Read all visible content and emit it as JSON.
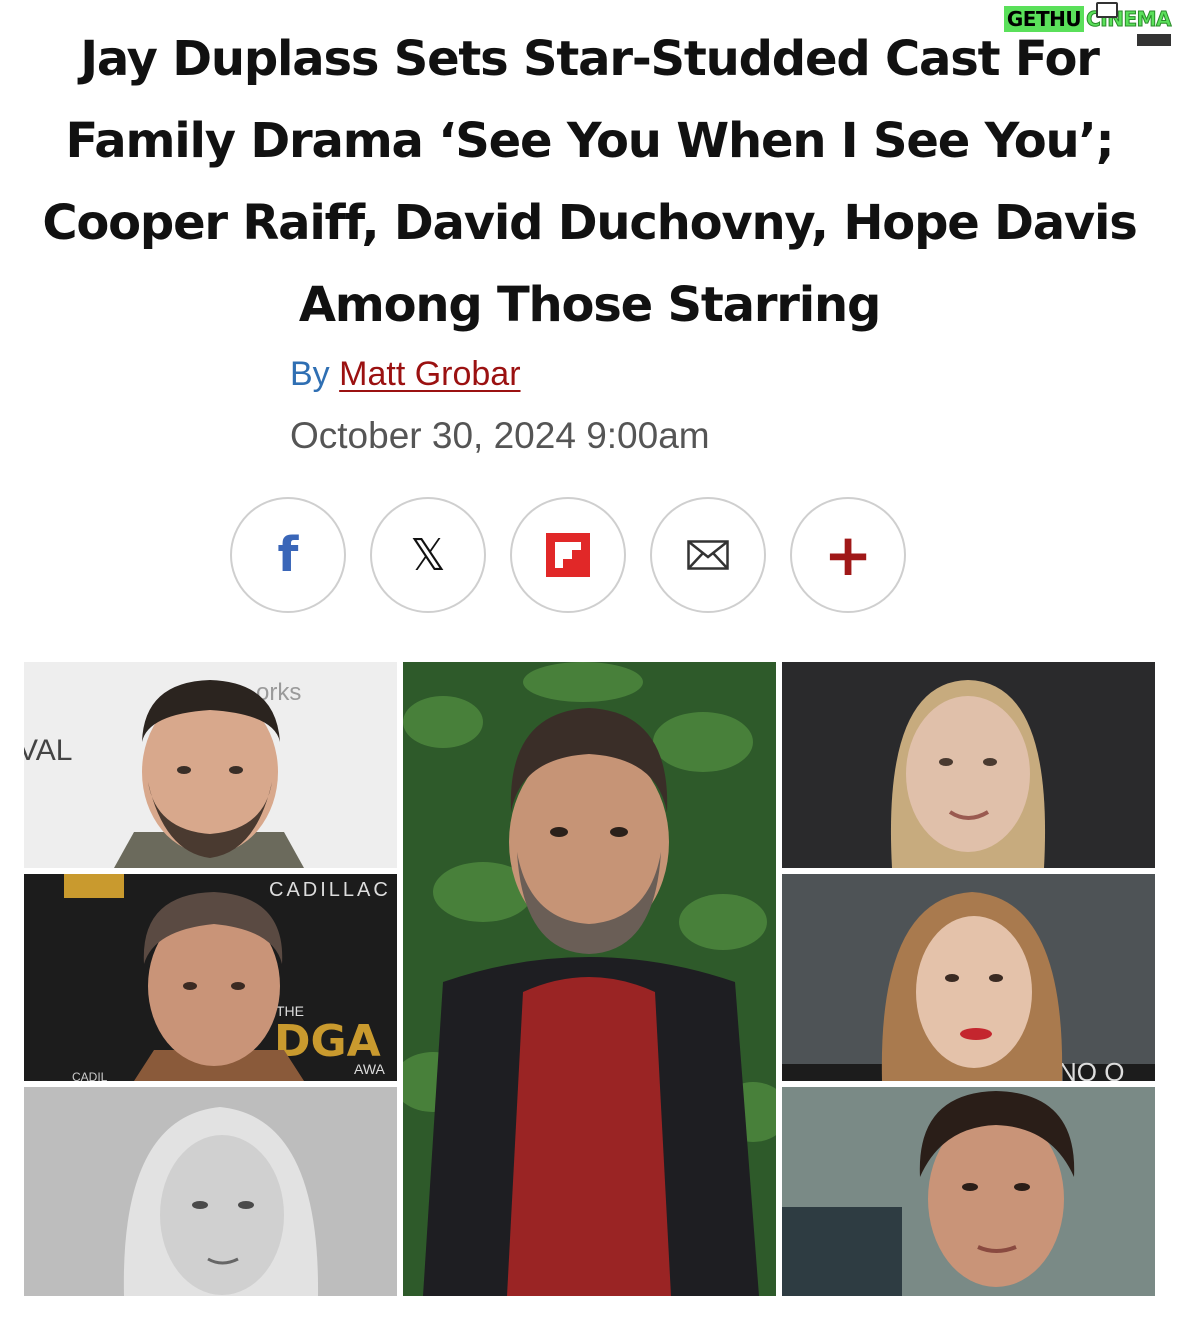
{
  "watermark": {
    "part1": "GETHU",
    "part2": "CINEMA"
  },
  "article": {
    "headline": "Jay Duplass Sets Star-Studded Cast For Family Drama ‘See You When I See You’; Cooper Raiff, David Duchovny, Hope Davis Among Those Starring",
    "byline_prefix": "By",
    "author": "Matt Grobar",
    "date": "October 30, 2024 9:00am"
  },
  "share": [
    {
      "name": "facebook",
      "icon": "facebook-icon"
    },
    {
      "name": "x",
      "icon": "x-icon"
    },
    {
      "name": "flipboard",
      "icon": "flipboard-icon",
      "color": "#e12828"
    },
    {
      "name": "email",
      "icon": "mail-icon"
    },
    {
      "name": "more",
      "icon": "plus-icon",
      "color": "#a01818"
    }
  ],
  "collage": {
    "backdrop_text": {
      "top_left_a": "orks",
      "top_left_b": "VAL",
      "mid_left_a": "CADILLAC",
      "mid_left_b": "THE",
      "mid_left_c": "DGA",
      "mid_left_d": "AWA",
      "mid_left_e": "CADIL",
      "mid_right": "NO O"
    }
  }
}
